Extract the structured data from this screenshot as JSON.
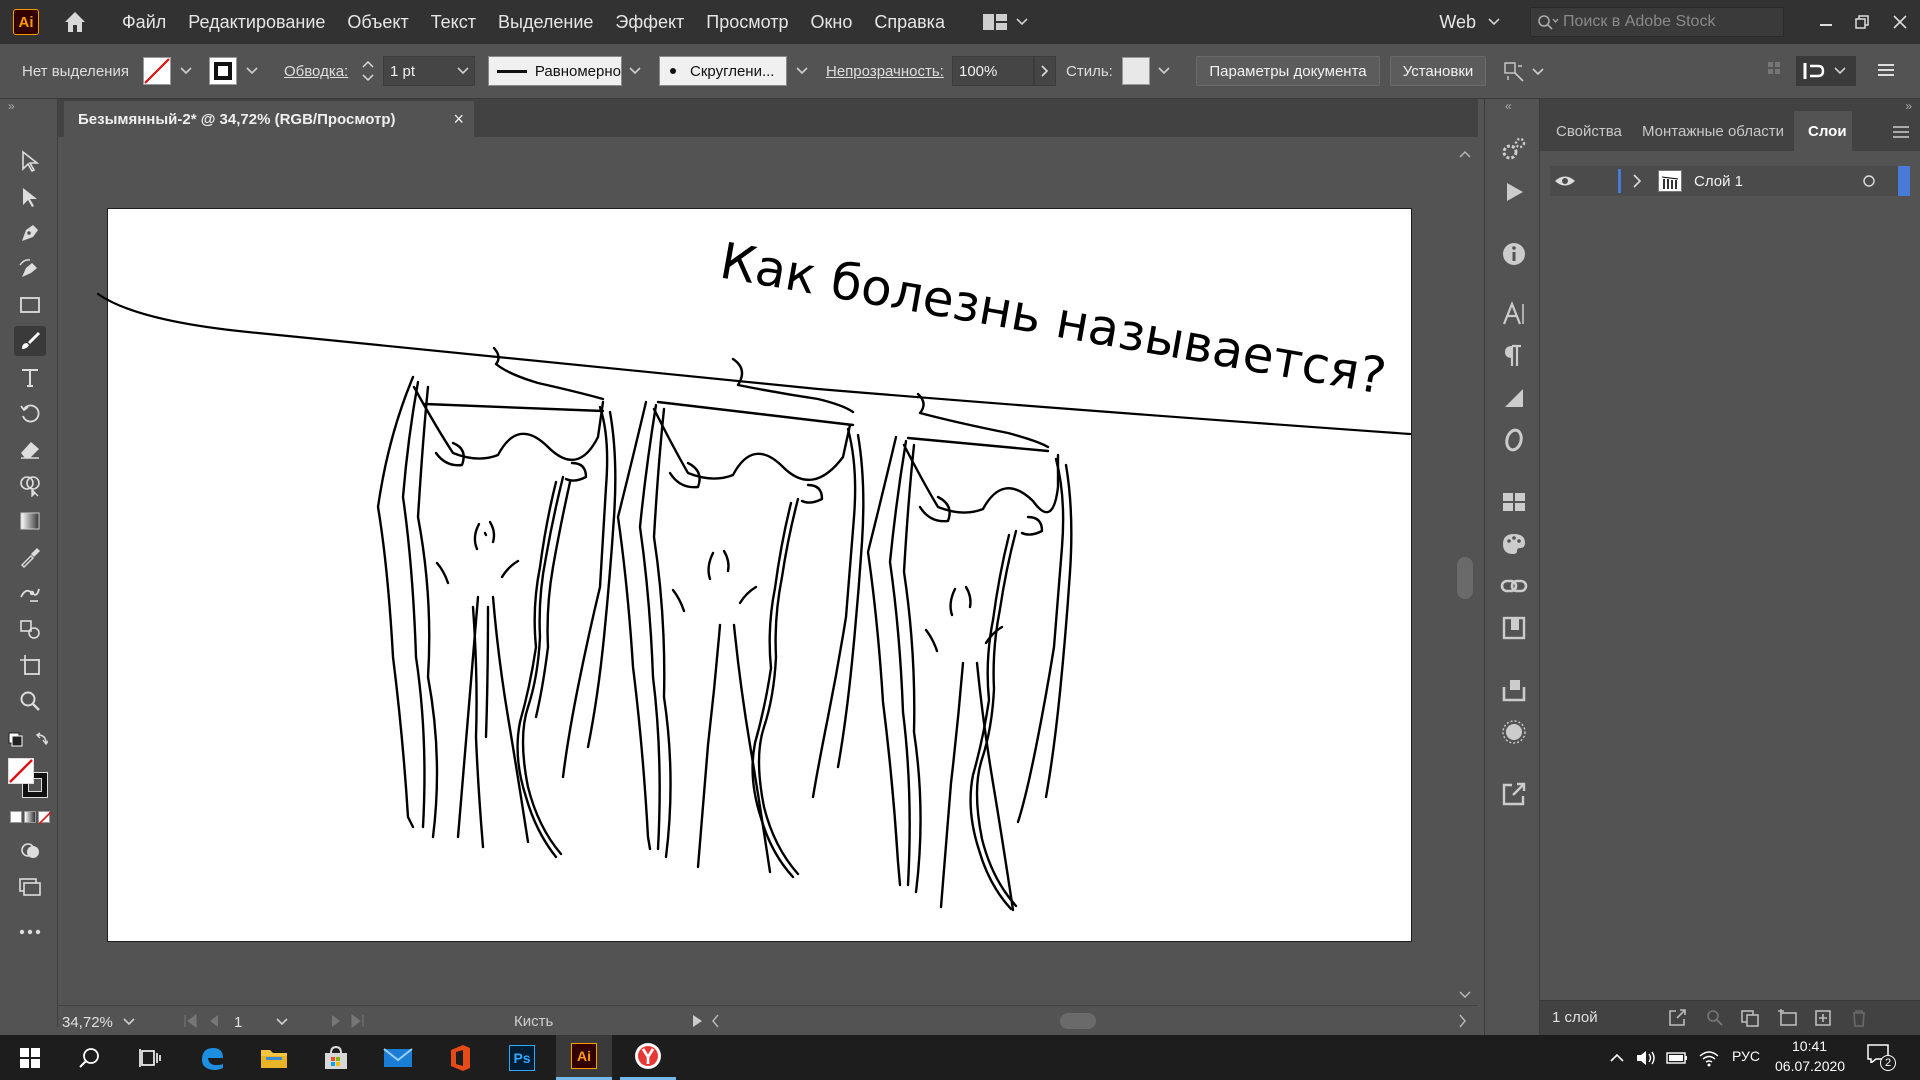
{
  "menubar": {
    "logo": "Ai",
    "items": [
      "Файл",
      "Редактирование",
      "Объект",
      "Текст",
      "Выделение",
      "Эффект",
      "Просмотр",
      "Окно",
      "Справка"
    ],
    "workspace": "Web",
    "search_placeholder": "Поиск в Adobe Stock"
  },
  "controlbar": {
    "selection": "Нет выделения",
    "stroke_label": "Обводка:",
    "stroke_weight": "1 pt",
    "stroke_profile": "Равномерно",
    "brush": "Скруглени...",
    "opacity_label": "Непрозрачность:",
    "opacity_value": "100%",
    "style_label": "Стиль:",
    "doc_settings": "Параметры документа",
    "preferences": "Установки"
  },
  "document": {
    "tab_title": "Безымянный-2* @ 34,72% (RGB/Просмотр)",
    "close": "×",
    "drawing_text": "Как болезнь называется?"
  },
  "statusbar": {
    "zoom": "34,72%",
    "artboard_number": "1",
    "current_tool": "Кисть"
  },
  "panel": {
    "tabs": [
      "Свойства",
      "Монтажные области",
      "Слои"
    ],
    "active_tab": "Слои",
    "layer_name": "Слой 1",
    "layer_count": "1 слой"
  },
  "taskbar": {
    "language": "РУС",
    "time": "10:41",
    "date": "06.07.2020",
    "notifications": "2"
  },
  "colors": {
    "ui_dark": "#323232",
    "ui_mid": "#535353",
    "panel_bg": "#424242",
    "illustrator_orange": "#ff9a00",
    "layer_blue": "#4a7ad8"
  }
}
